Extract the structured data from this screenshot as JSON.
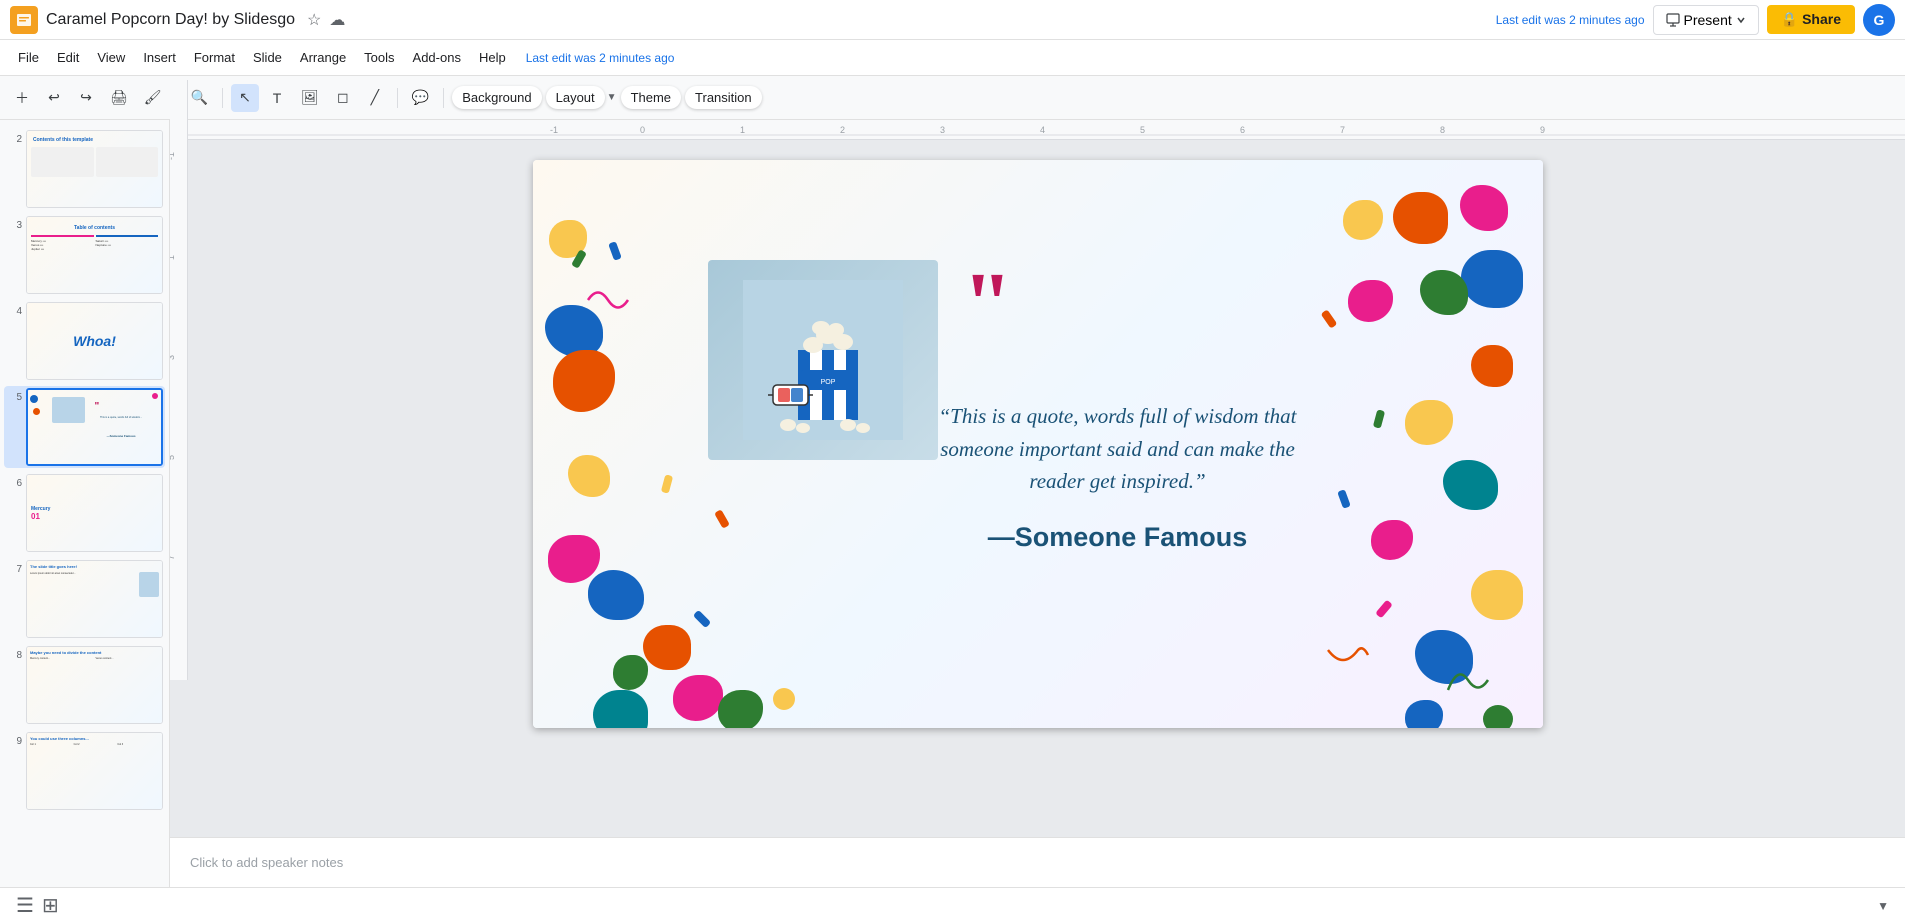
{
  "titleBar": {
    "appName": "Caramel Popcorn Day! by Slidesgo",
    "lastEdit": "Last edit was 2 minutes ago",
    "presentLabel": "Present",
    "shareLabel": "Share",
    "avatarInitial": "G"
  },
  "menuBar": {
    "items": [
      "File",
      "Edit",
      "View",
      "Insert",
      "Format",
      "Slide",
      "Arrange",
      "Tools",
      "Add-ons",
      "Help"
    ]
  },
  "toolbar": {
    "slideToolbar": {
      "background": "Background",
      "layout": "Layout",
      "theme": "Theme",
      "transition": "Transition"
    }
  },
  "slides": [
    {
      "num": "2",
      "active": false
    },
    {
      "num": "3",
      "active": false
    },
    {
      "num": "4",
      "active": false
    },
    {
      "num": "5",
      "active": true
    },
    {
      "num": "6",
      "active": false
    },
    {
      "num": "7",
      "active": false
    },
    {
      "num": "8",
      "active": false
    },
    {
      "num": "9",
      "active": false
    }
  ],
  "currentSlide": {
    "quoteText": "“This is a quote, words full of wisdom that someone important said and can make the reader get inspired.”",
    "quoteAuthor": "—Someone Famous"
  },
  "speakerNotes": {
    "placeholder": "Click to add speaker notes"
  },
  "bottomBar": {
    "slideViewIcon": "☰",
    "gridViewIcon": "⋮"
  },
  "colors": {
    "pink": "#e91e8c",
    "blue": "#1565c0",
    "orange": "#e65100",
    "green": "#2e7d32",
    "yellow": "#f9a825",
    "teal": "#00838f",
    "red": "#c62828",
    "purple": "#6a1b9a",
    "accent": "#fbbc04"
  }
}
